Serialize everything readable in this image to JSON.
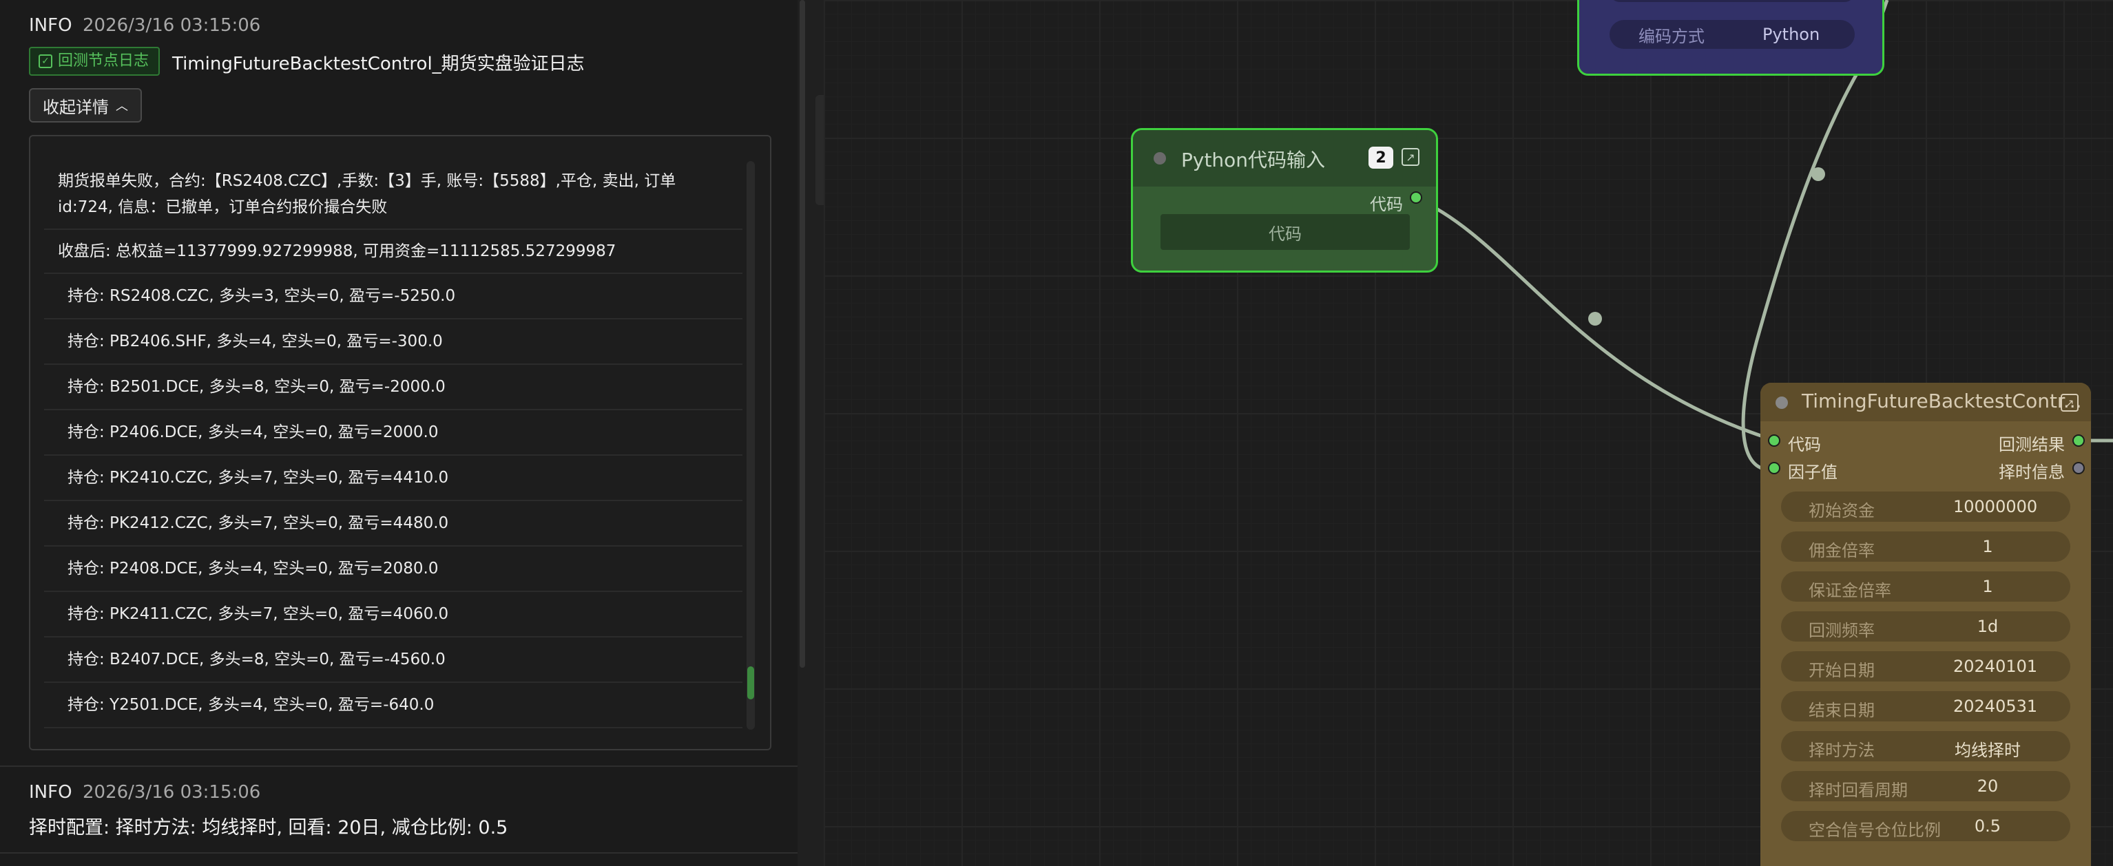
{
  "log": {
    "entry1": {
      "level": "INFO",
      "timestamp": "2026/3/16 03:15:06",
      "tag": "回测节点日志",
      "title": "TimingFutureBacktestControl_期货实盘验证日志",
      "collapse_label": "收起详情",
      "lines": [
        "期货报单失败，合约:【RS2408.CZC】,手数:【3】手, 账号:【5588】,平仓, 卖出, 订单id:724, 信息：已撤单，订单合约报价撮合失败",
        "收盘后: 总权益=11377999.927299988, 可用资金=11112585.527299987",
        "持仓: RS2408.CZC, 多头=3, 空头=0, 盈亏=-5250.0",
        "持仓: PB2406.SHF, 多头=4, 空头=0, 盈亏=-300.0",
        "持仓: B2501.DCE, 多头=8, 空头=0, 盈亏=-2000.0",
        "持仓: P2406.DCE, 多头=4, 空头=0, 盈亏=2000.0",
        "持仓: PK2410.CZC, 多头=7, 空头=0, 盈亏=4410.0",
        "持仓: PK2412.CZC, 多头=7, 空头=0, 盈亏=4480.0",
        "持仓: P2408.DCE, 多头=4, 空头=0, 盈亏=2080.0",
        "持仓: PK2411.CZC, 多头=7, 空头=0, 盈亏=4060.0",
        "持仓: B2407.DCE, 多头=8, 空头=0, 盈亏=-4560.0",
        "持仓: Y2501.DCE, 多头=4, 空头=0, 盈亏=-640.0"
      ]
    },
    "entry2": {
      "level": "INFO",
      "timestamp": "2026/3/16 03:15:06",
      "text": "择时配置: 择时方法: 均线择时, 回看: 20日, 减仓比例: 0.5"
    }
  },
  "nodes": {
    "top_partial": {
      "field_label": "编码方式",
      "field_value": "Python"
    },
    "python_input": {
      "title": "Python代码输入",
      "badge": "2",
      "output_label": "代码",
      "field": "代码"
    },
    "timing_backtest": {
      "title": "TimingFutureBacktestContr...",
      "inputs": [
        "代码",
        "因子值"
      ],
      "outputs": [
        "回测结果",
        "择时信息"
      ],
      "fields": [
        {
          "label": "初始资金",
          "value": "10000000"
        },
        {
          "label": "佣金倍率",
          "value": "1"
        },
        {
          "label": "保证金倍率",
          "value": "1"
        },
        {
          "label": "回测频率",
          "value": "1d"
        },
        {
          "label": "开始日期",
          "value": "20240101"
        },
        {
          "label": "结束日期",
          "value": "20240531"
        },
        {
          "label": "择时方法",
          "value": "均线择时"
        },
        {
          "label": "择时回看周期",
          "value": "20"
        },
        {
          "label": "空合信号仓位比例",
          "value": "0.5"
        }
      ]
    }
  },
  "colors": {
    "selected_border": "#3ed13e",
    "port_active": "#5cd05c",
    "tag_green": "#56c15c",
    "wire": "#a7b7a3"
  }
}
